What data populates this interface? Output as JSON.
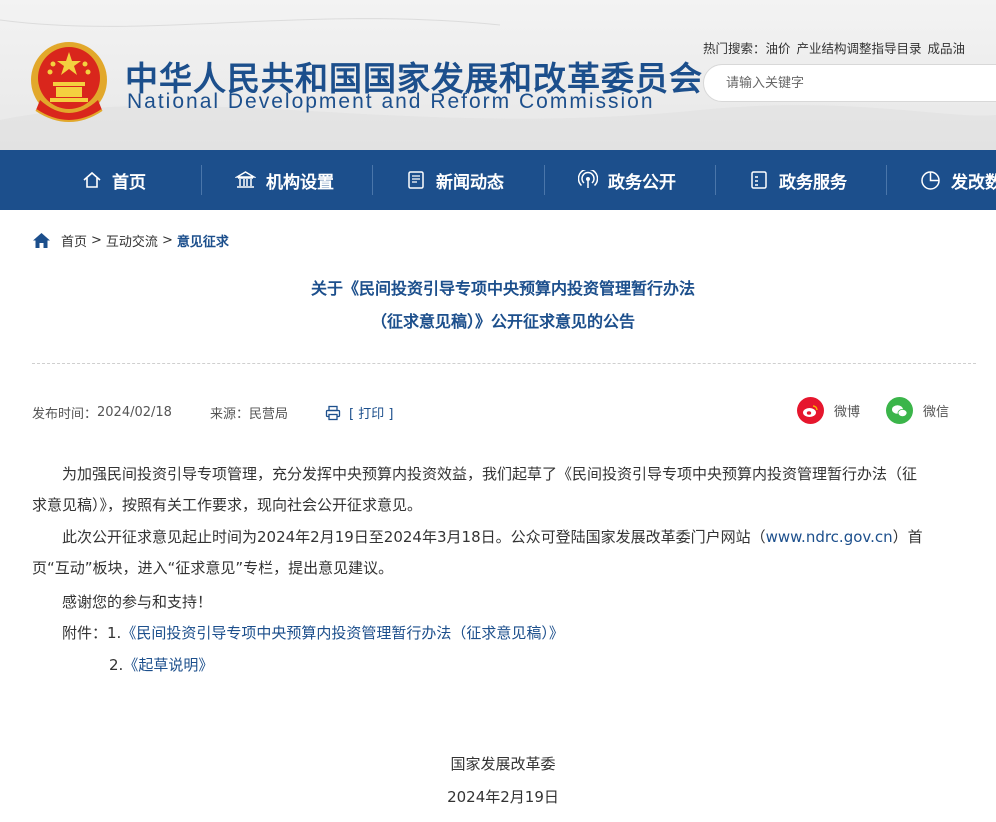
{
  "header": {
    "title_cn": "中华人民共和国国家发展和改革委员会",
    "title_en": "National Development and Reform Commission",
    "hot_label": "热门搜索：",
    "hot_items": [
      "油价",
      "产业结构调整指导目录",
      "成品油"
    ],
    "search_placeholder": "请输入关键字"
  },
  "nav": {
    "items": [
      {
        "label": "首页",
        "icon": "home-icon"
      },
      {
        "label": "机构设置",
        "icon": "building-icon"
      },
      {
        "label": "新闻动态",
        "icon": "news-icon"
      },
      {
        "label": "政务公开",
        "icon": "broadcast-icon"
      },
      {
        "label": "政务服务",
        "icon": "service-icon"
      },
      {
        "label": "发改数",
        "icon": "pie-chart-icon"
      }
    ]
  },
  "breadcrumb": {
    "items": [
      "首页",
      "互动交流",
      "意见征求"
    ],
    "sep": ">"
  },
  "article": {
    "title_line1": "关于《民间投资引导专项中央预算内投资管理暂行办法",
    "title_line2": "（征求意见稿）》公开征求意见的公告",
    "date_label": "发布时间：",
    "date": "2024/02/18",
    "source_label": "来源：",
    "source": "民营局",
    "print_label": "[ 打印 ]",
    "share_weibo": "微博",
    "share_wechat": "微信",
    "para1_line1": "为加强民间投资引导专项管理，充分发挥中央预算内投资效益，我们起草了《民间投资引导专项中央预算内投资管理暂行办法（征",
    "para1_line2": "求意见稿）》，按照有关工作要求，现向社会公开征求意见。",
    "para2_line1_a": "此次公开征求意见起止时间为2024年2月19日至2024年3月18日。公众可登陆国家发展改革委门户网站（",
    "para2_link": "www.ndrc.gov.cn",
    "para2_line1_b": "）首",
    "para2_line2": "页“互动”板块，进入“征求意见”专栏，提出意见建议。",
    "para3": "感谢您的参与和支持！",
    "attach_label": "附件：",
    "attach1_num": "1.",
    "attach1": "《民间投资引导专项中央预算内投资管理暂行办法（征求意见稿）》",
    "attach2_num": "2.",
    "attach2": "《起草说明》",
    "signature": "国家发展改革委",
    "sign_date": "2024年2月19日"
  },
  "colors": {
    "brand": "#1c4f8c",
    "weibo": "#e6162d",
    "wechat": "#3bb54a"
  }
}
